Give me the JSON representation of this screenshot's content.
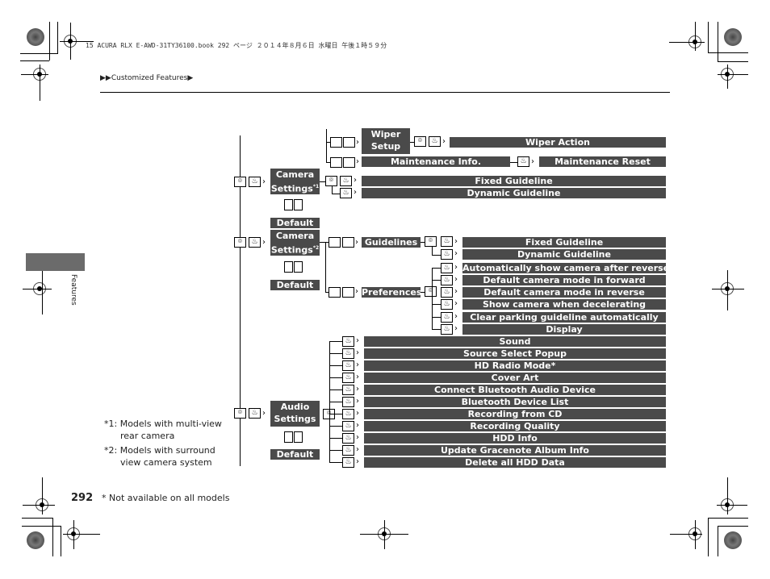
{
  "header": {
    "print_slug": "15 ACURA RLX E-AWD-31TY36100.book  292 ページ  ２０１４年８月６日  水曜日  午後１時５９分",
    "breadcrumb": "▶▶Customized Features▶"
  },
  "side_tab": {
    "label": "Features"
  },
  "tree": {
    "camera1": {
      "label_line1": "Camera",
      "label_line2": "Settings",
      "sup": "*1",
      "default": "Default"
    },
    "camera2": {
      "label_line1": "Camera",
      "label_line2": "Settings",
      "sup": "*2",
      "default": "Default"
    },
    "audio": {
      "label_line1": "Audio",
      "label_line2": "Settings",
      "default": "Default"
    },
    "wiper": {
      "label_line1": "Wiper",
      "label_line2": "Setup",
      "action": "Wiper Action"
    },
    "maintenance": {
      "info": "Maintenance Info.",
      "reset": "Maintenance Reset"
    },
    "camera1_items": [
      "Fixed Guideline",
      "Dynamic Guideline"
    ],
    "guidelines": {
      "label": "Guidelines",
      "items": [
        "Fixed Guideline",
        "Dynamic Guideline"
      ]
    },
    "preferences": {
      "label": "Preferences",
      "items": [
        "Automatically show camera after reverse",
        "Default camera mode in forward",
        "Default camera mode in reverse",
        "Show camera when decelerating",
        "Clear parking guideline automatically",
        "Display"
      ]
    },
    "audio_items": [
      "Sound",
      "Source Select Popup",
      "HD Radio Mode*",
      "Cover Art",
      "Connect Bluetooth Audio Device",
      "Bluetooth Device List",
      "Recording from CD",
      "Recording Quality",
      "HDD Info",
      "Update Gracenote Album Info",
      "Delete all HDD Data"
    ]
  },
  "icons": {
    "dial": "⌾",
    "press": "♨",
    "tilt": "⇆"
  },
  "footnotes": {
    "n1_a": "*1: Models with multi-view",
    "n1_b": "rear camera",
    "n2_a": "*2: Models with surround",
    "n2_b": "view camera system"
  },
  "footer": {
    "page_number": "292",
    "note": "* Not available on all models"
  },
  "colors": {
    "bar": "#4a4a4a",
    "tab": "#6b6b6b"
  }
}
